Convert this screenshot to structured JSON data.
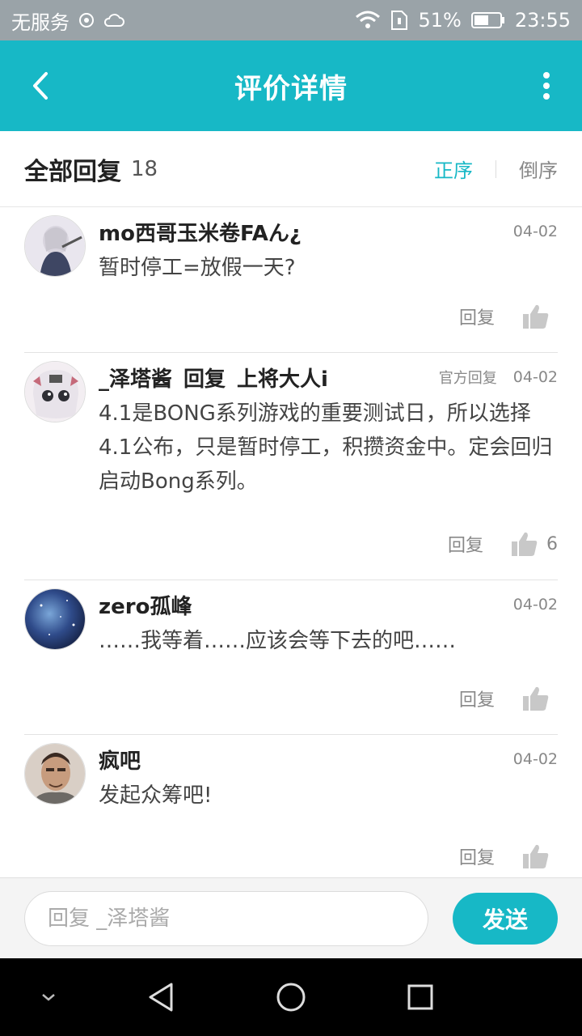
{
  "status_bar": {
    "carrier": "无服务",
    "battery": "51%",
    "time": "23:55"
  },
  "app_bar": {
    "title": "评价详情"
  },
  "section": {
    "title": "全部回复",
    "count": "18",
    "sort_ascending": "正序",
    "sort_descending": "倒序"
  },
  "comments": [
    {
      "name": "mo西哥玉米卷FAん¿",
      "date": "04-02",
      "text": "暂时停工=放假一天?",
      "reply_label": "回复",
      "likes": ""
    },
    {
      "name": "_泽塔酱",
      "reply_word": "回复",
      "reply_target": "上将大人i",
      "official": "官方回复",
      "date": "04-02",
      "text": "4.1是BONG系列游戏的重要测试日，所以选择4.1公布，只是暂时停工，积攒资金中。定会回归启动Bong系列。",
      "reply_label": "回复",
      "likes": "6"
    },
    {
      "name": "zero孤峰",
      "date": "04-02",
      "text": "……我等着……应该会等下去的吧……",
      "reply_label": "回复",
      "likes": ""
    },
    {
      "name": "疯吧",
      "date": "04-02",
      "text": "发起众筹吧!",
      "reply_label": "回复",
      "likes": ""
    }
  ],
  "input_bar": {
    "placeholder": "回复 _泽塔酱",
    "send_label": "发送"
  },
  "colors": {
    "accent": "#17b8c6",
    "status_bar": "#9aa3a8"
  },
  "icons": [
    "back-arrow-icon",
    "more-vert-icon",
    "thumb-up-icon",
    "wifi-icon",
    "battery-icon",
    "nav-back-icon",
    "nav-home-icon",
    "nav-recents-icon",
    "nav-collapse-icon"
  ]
}
